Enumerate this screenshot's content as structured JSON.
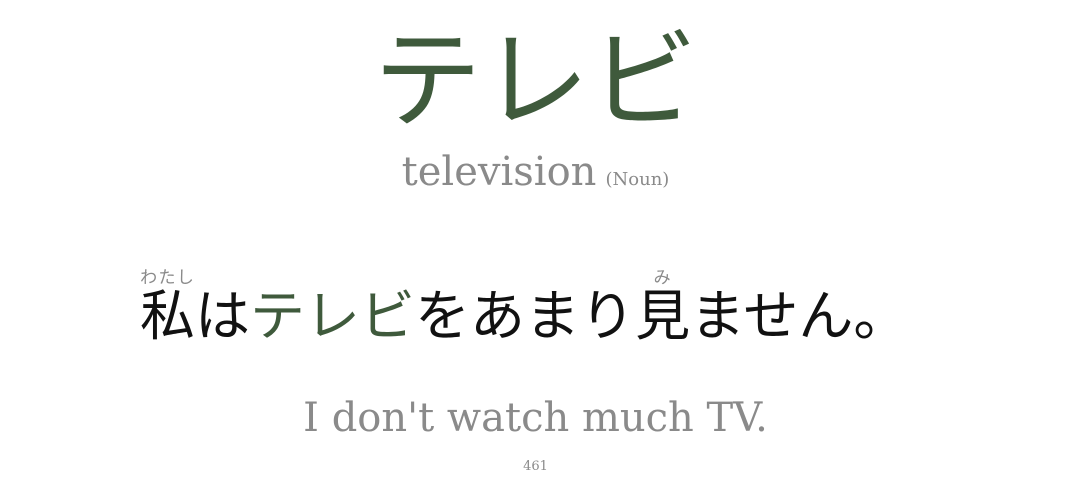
{
  "card": {
    "headword": "テレビ",
    "meaning": "television",
    "part_of_speech": "(Noun)",
    "sentence": {
      "part1_kanji": "私",
      "part1_reading": "わたし",
      "part2": "は",
      "target": "テレビ",
      "part3": "をあまり",
      "part4_kanji": "見",
      "part4_reading": "み",
      "part5": "ません。"
    },
    "translation": "I don't watch much TV.",
    "number": "461"
  },
  "colors": {
    "accent": "#3f5a3c",
    "muted": "#8a8a8a",
    "text": "#111111",
    "background": "#ffffff"
  }
}
